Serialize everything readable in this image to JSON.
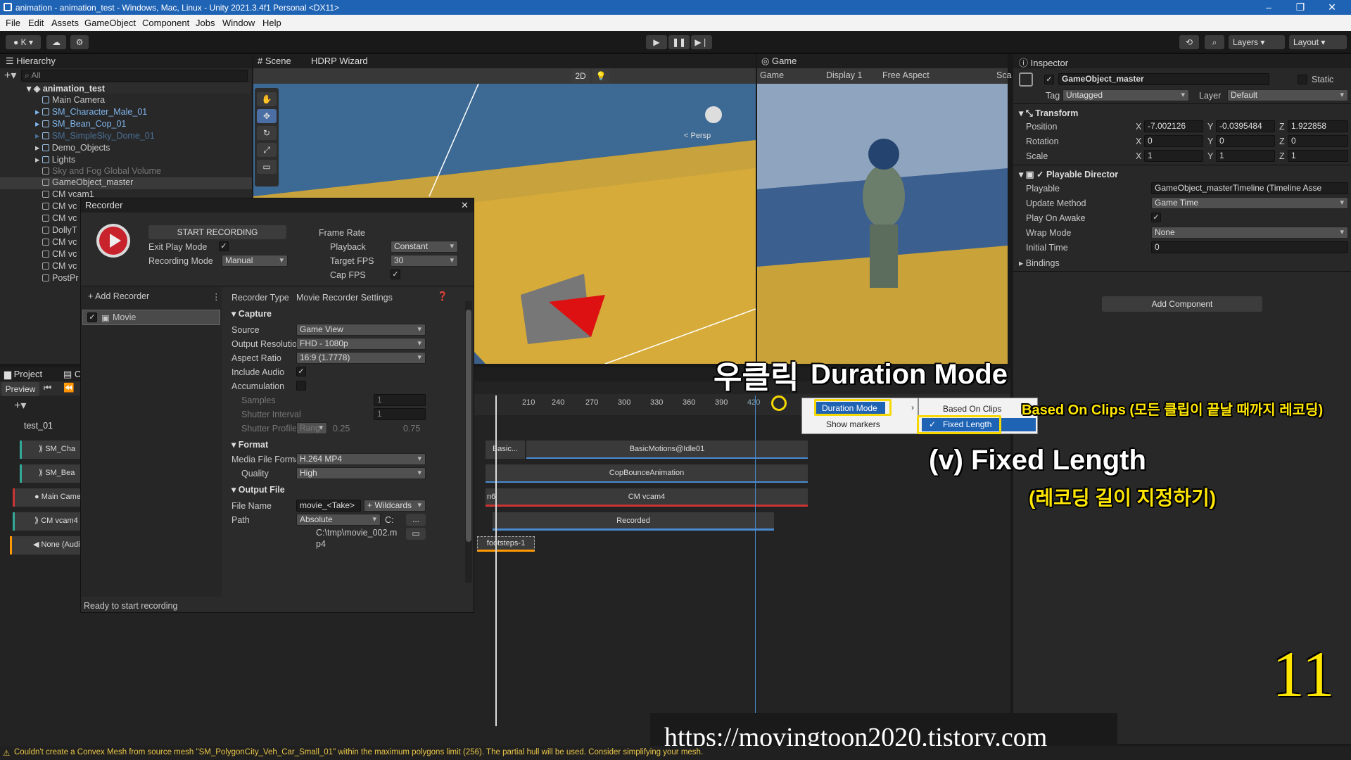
{
  "window": {
    "title": "animation - animation_test - Windows, Mac, Linux - Unity 2021.3.4f1 Personal <DX11>"
  },
  "menu": [
    "File",
    "Edit",
    "Assets",
    "GameObject",
    "Component",
    "Jobs",
    "Window",
    "Help"
  ],
  "toolbar": {
    "account": "K",
    "layers": "Layers",
    "layout": "Layout"
  },
  "hierarchy": {
    "tab": "Hierarchy",
    "search": "All",
    "items": [
      "animation_test",
      "Main Camera",
      "SM_Character_Male_01",
      "SM_Bean_Cop_01",
      "SM_SimpleSky_Dome_01",
      "Demo_Objects",
      "Lights",
      "Sky and Fog Global Volume",
      "GameObject_master",
      "CM vcam1",
      "CM vc",
      "CM vc",
      "DollyT",
      "CM vc",
      "CM vc",
      "CM vc",
      "PostPr"
    ]
  },
  "scene": {
    "tabs": [
      "Scene",
      "HDRP Wizard"
    ],
    "toggle_2d": "2D",
    "persp": "< Persp"
  },
  "game": {
    "tab": "Game",
    "display_mode": "Game",
    "display": "Display 1",
    "aspect": "Free Aspect",
    "scale": "Sca"
  },
  "recorder": {
    "title": "Recorder",
    "start": "START RECORDING",
    "exit_play_mode": "Exit Play Mode",
    "recording_mode_label": "Recording Mode",
    "recording_mode": "Manual",
    "frame_rate": "Frame Rate",
    "playback_label": "Playback",
    "playback": "Constant",
    "target_fps_label": "Target FPS",
    "target_fps": "30",
    "cap_fps": "Cap FPS",
    "add_recorder": "+ Add Recorder",
    "movie": "Movie",
    "recorder_type_label": "Recorder Type",
    "recorder_type": "Movie Recorder Settings",
    "capture": "Capture",
    "source_label": "Source",
    "source": "Game View",
    "output_resolution_label": "Output Resolution",
    "output_resolution": "FHD - 1080p",
    "aspect_ratio_label": "Aspect Ratio",
    "aspect_ratio": "16:9 (1.7778)",
    "include_audio": "Include Audio",
    "accumulation": "Accumulation",
    "samples": "Samples",
    "samples_val": "1",
    "shutter_interval": "Shutter Interval",
    "shutter_interval_val": "1",
    "shutter_profile": "Shutter Profile",
    "shutter_profile_mode": "Rang",
    "shutter_min": "0.25",
    "shutter_max": "0.75",
    "format": "Format",
    "media_file_format_label": "Media File Format",
    "media_file_format": "H.264 MP4",
    "quality_label": "Quality",
    "quality": "High",
    "output_file": "Output File",
    "file_name_label": "File Name",
    "file_name": "movie_<Take>",
    "wildcards": "+ Wildcards",
    "path_label": "Path",
    "path_mode": "Absolute",
    "path_drive": "C:",
    "path_more": "...",
    "path_value": "C:\\tmp\\movie_002.m",
    "path_value2": "p4",
    "status": "Ready to start recording"
  },
  "project": {
    "tab": "Project",
    "tab2": "C"
  },
  "timeline": {
    "preview": "Preview",
    "asset": "test_01",
    "tracks": [
      "SM_Cha",
      "SM_Bea",
      "Main Came",
      "CM vcam4",
      "None (Audi"
    ],
    "ticks": [
      "210",
      "240",
      "270",
      "300",
      "330",
      "360",
      "390",
      "420"
    ],
    "clips": [
      "Basic...",
      "BasicMotions@Idle01",
      "CopBounceAnimation",
      "CM vcam4",
      "Recorded",
      "footsteps-1"
    ],
    "clip_prefix": "n6",
    "context_menu": {
      "item1": "Duration Mode",
      "item2": "Show markers",
      "sub1": "Based On Clips",
      "sub2": "Fixed Length"
    }
  },
  "inspector": {
    "tab": "Inspector",
    "object": "GameObject_master",
    "static": "Static",
    "tag_label": "Tag",
    "tag": "Untagged",
    "layer_label": "Layer",
    "layer": "Default",
    "transform": "Transform",
    "position_label": "Position",
    "position": {
      "x": "-7.002126",
      "y": "-0.0395484",
      "z": "1.922858"
    },
    "rotation_label": "Rotation",
    "rotation": {
      "x": "0",
      "y": "0",
      "z": "0"
    },
    "scale_label": "Scale",
    "scale": {
      "x": "1",
      "y": "1",
      "z": "1"
    },
    "axes": [
      "X",
      "Y",
      "Z"
    ],
    "playable_director": "Playable Director",
    "playable_label": "Playable",
    "playable": "GameObject_masterTimeline (Timeline Asse",
    "update_method_label": "Update Method",
    "update_method": "Game Time",
    "play_on_awake": "Play On Awake",
    "wrap_mode_label": "Wrap Mode",
    "wrap_mode": "None",
    "initial_time_label": "Initial Time",
    "initial_time": "0",
    "bindings": "Bindings",
    "add_component": "Add Component"
  },
  "annotations": {
    "right_click": "우클릭",
    "duration_mode": "Duration Mode",
    "based_on_clips": "Based On Clips (모든 클립이 끝날 때까지 레코딩)",
    "fixed_length": "(v) Fixed Length",
    "fixed_length_sub": "(레코딩 길이 지정하기)",
    "step": "11",
    "url": "https://movingtoon2020.tistory.com"
  },
  "console": {
    "warning": "Couldn't create a Convex Mesh from source mesh \"SM_PolygonCity_Veh_Car_Small_01\" within the maximum polygons limit (256). The partial hull will be used. Consider simplifying your mesh."
  }
}
